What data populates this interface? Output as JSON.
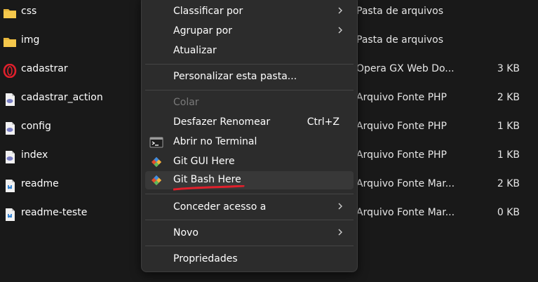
{
  "files": [
    {
      "name": "css",
      "type": "Pasta de arquivos",
      "size": "",
      "icon": "folder-icon"
    },
    {
      "name": "img",
      "type": "Pasta de arquivos",
      "size": "",
      "icon": "folder-icon"
    },
    {
      "name": "cadastrar",
      "type": "Opera GX Web Do...",
      "size": "3 KB",
      "icon": "opera-gx-icon"
    },
    {
      "name": "cadastrar_action",
      "type": "Arquivo Fonte PHP",
      "size": "2 KB",
      "icon": "php-file-icon"
    },
    {
      "name": "config",
      "type": "Arquivo Fonte PHP",
      "size": "1 KB",
      "icon": "php-file-icon"
    },
    {
      "name": "index",
      "type": "Arquivo Fonte PHP",
      "size": "1 KB",
      "icon": "php-file-icon"
    },
    {
      "name": "readme",
      "type": "Arquivo Fonte Mar...",
      "size": "2 KB",
      "icon": "markdown-file-icon"
    },
    {
      "name": "readme-teste",
      "type": "Arquivo Fonte Mar...",
      "size": "0 KB",
      "icon": "markdown-file-icon"
    }
  ],
  "context_menu": {
    "items": [
      {
        "label": "Classificar por",
        "submenu": true
      },
      {
        "label": "Agrupar por",
        "submenu": true
      },
      {
        "label": "Atualizar"
      },
      {
        "label": "Personalizar esta pasta..."
      },
      {
        "label": "Colar",
        "disabled": true
      },
      {
        "label": "Desfazer Renomear",
        "shortcut": "Ctrl+Z"
      },
      {
        "label": "Abrir no Terminal",
        "icon": "terminal-icon"
      },
      {
        "label": "Git GUI Here",
        "icon": "git-icon"
      },
      {
        "label": "Git Bash Here",
        "icon": "git-icon",
        "highlighted": true
      },
      {
        "label": "Conceder acesso a",
        "submenu": true
      },
      {
        "label": "Novo",
        "submenu": true
      },
      {
        "label": "Propriedades"
      }
    ]
  },
  "colors": {
    "background": "#191919",
    "menu_background": "#2c2c2c",
    "highlight": "#383838",
    "folder": "#e8b73c",
    "annotation_underline": "#e0202c"
  }
}
